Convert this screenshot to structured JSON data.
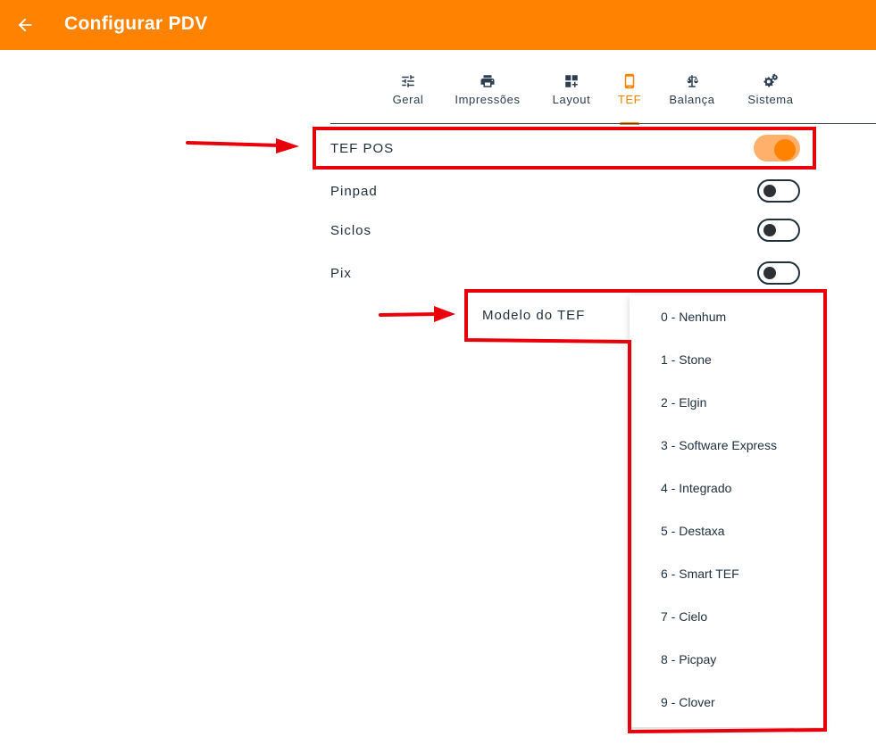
{
  "header": {
    "title": "Configurar PDV",
    "back_icon": "arrow-left-icon",
    "color": "#ff8200"
  },
  "tabs": [
    {
      "label": "Geral",
      "icon": "sliders-icon",
      "active": false
    },
    {
      "label": "Impressões",
      "icon": "printer-icon",
      "active": false
    },
    {
      "label": "Layout",
      "icon": "dashboard-add-icon",
      "active": false
    },
    {
      "label": "TEF",
      "icon": "mobile-phone-icon",
      "active": true
    },
    {
      "label": "Balança",
      "icon": "scale-icon",
      "active": false
    },
    {
      "label": "Sistema",
      "icon": "gears-icon",
      "active": false
    }
  ],
  "settings": [
    {
      "label": "TEF POS",
      "enabled": true
    },
    {
      "label": "Pinpad",
      "enabled": false
    },
    {
      "label": "Siclos",
      "enabled": false
    },
    {
      "label": "Pix",
      "enabled": false
    }
  ],
  "tef_model": {
    "label": "Modelo do TEF",
    "options": [
      "0 - Nenhum",
      "1 - Stone",
      "2 - Elgin",
      "3 - Software Express",
      "4 - Integrado",
      "5 - Destaxa",
      "6 - Smart TEF",
      "7 - Cielo",
      "8 - Picpay",
      "9 - Clover"
    ]
  },
  "annotation_color": "#e8000b"
}
